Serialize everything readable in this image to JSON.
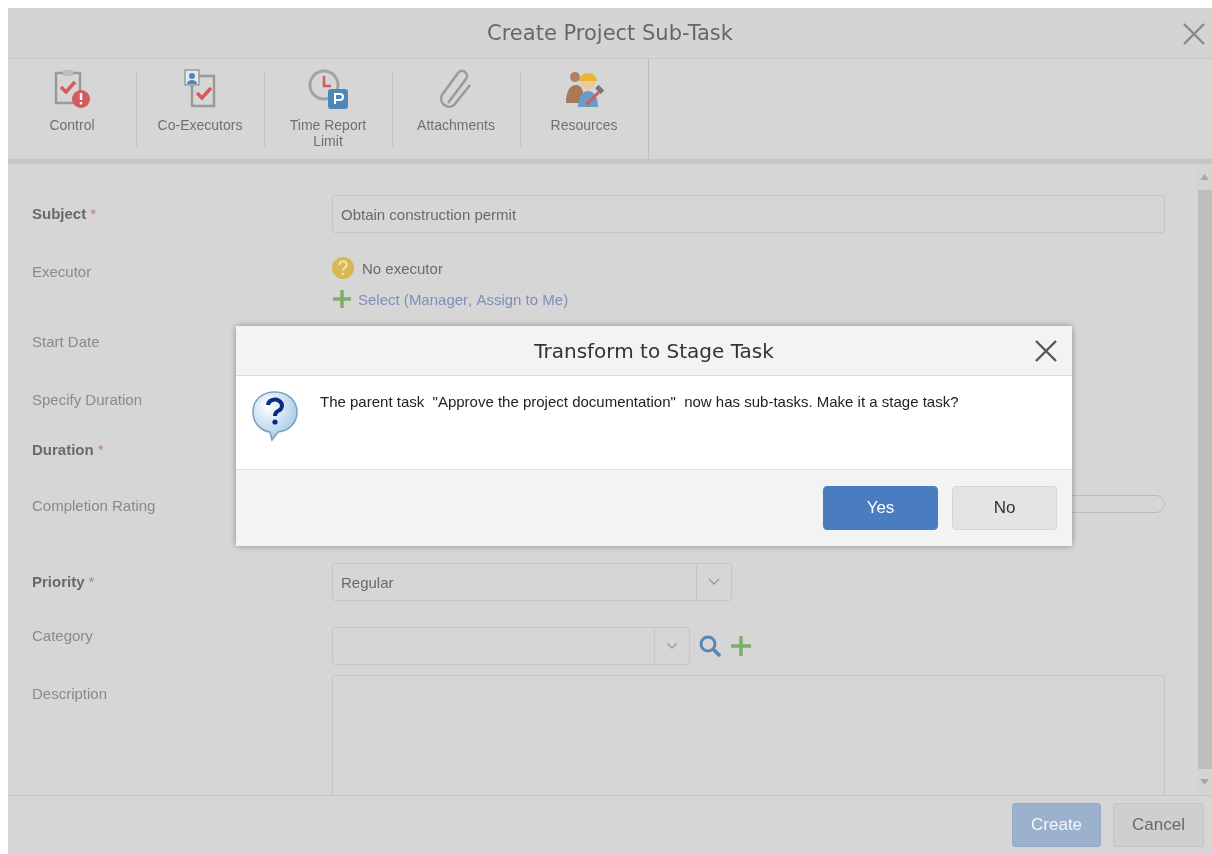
{
  "window": {
    "title": "Create Project Sub-Task"
  },
  "toolbar": [
    {
      "label": "Control",
      "kind": "control"
    },
    {
      "label": "Co-Executors",
      "kind": "coexecutors"
    },
    {
      "label": "Time Report Limit",
      "kind": "timelimit"
    },
    {
      "label": "Attachments",
      "kind": "attachments"
    },
    {
      "label": "Resources",
      "kind": "resources"
    }
  ],
  "form": {
    "required_mark": "*",
    "rows": [
      {
        "kind": "text",
        "label": "Subject",
        "required": true,
        "value": "Obtain construction permit"
      },
      {
        "kind": "executor",
        "label": "Executor",
        "required": false,
        "value": "No executor",
        "select": "Select",
        "open": "(",
        "options": [
          "Manager",
          "Assign to Me"
        ],
        "separator": ", ",
        "close": ")"
      },
      {
        "kind": "date",
        "label": "Start Date",
        "required": false
      },
      {
        "kind": "toggle",
        "label": "Specify Duration",
        "required": false
      },
      {
        "kind": "duration",
        "label": "Duration",
        "required": true
      },
      {
        "kind": "rating",
        "label": "Completion Rating",
        "required": false
      },
      {
        "kind": "select",
        "label": "Priority",
        "required": true,
        "value": "Regular"
      },
      {
        "kind": "category",
        "label": "Category",
        "required": false
      },
      {
        "kind": "textarea",
        "label": "Description",
        "required": false
      }
    ]
  },
  "footer": {
    "buttons": [
      {
        "label": "Create",
        "primary": true,
        "disabled": true
      },
      {
        "label": "Cancel",
        "primary": false,
        "disabled": false
      }
    ]
  },
  "dialog": {
    "title": "Transform to Stage Task",
    "message": "The parent task  \"Approve the project documentation\"  now has sub-tasks. Make it a stage task?",
    "buttons": [
      {
        "label": "Yes",
        "primary": true
      },
      {
        "label": "No",
        "primary": false
      }
    ]
  }
}
